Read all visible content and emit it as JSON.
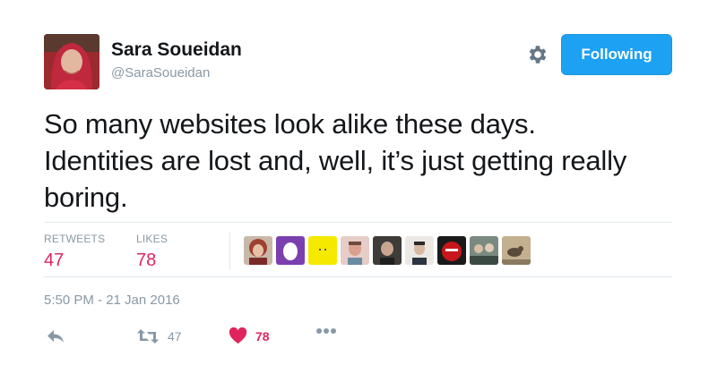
{
  "user": {
    "name": "Sara Soueidan",
    "handle": "@SaraSoueidan"
  },
  "follow_button": {
    "label": "Following"
  },
  "tweet": {
    "lines": [
      "So many websites look alike these days.",
      "Identities are lost and, well, it’s just getting really",
      "boring."
    ]
  },
  "stats": {
    "retweets_label": "RETWEETS",
    "retweets_count": "47",
    "likes_label": "LIKES",
    "likes_count": "78"
  },
  "likers": [
    {
      "icon": "red-haired-person-avatar",
      "color": "#a04a3c"
    },
    {
      "icon": "purple-egg-avatar",
      "color": "#7b3fb0"
    },
    {
      "icon": "yellow-square-avatar",
      "color": "#f2e600"
    },
    {
      "icon": "pink-person-avatar",
      "color": "#d9a5a0"
    },
    {
      "icon": "dark-person-avatar",
      "color": "#4c4a46"
    },
    {
      "icon": "person-avatar",
      "color": "#d8d4d0"
    },
    {
      "icon": "red-object-avatar",
      "color": "#c2161c"
    },
    {
      "icon": "group-photo-avatar",
      "color": "#6d7a70"
    },
    {
      "icon": "bird-avatar",
      "color": "#b9a68a"
    }
  ],
  "timestamp": "5:50 PM - 21 Jan 2016",
  "actions": {
    "retweet_count": "47",
    "like_count": "78"
  },
  "colors": {
    "accent": "#1da1f2",
    "like": "#e0245e",
    "muted": "#8899a6"
  }
}
